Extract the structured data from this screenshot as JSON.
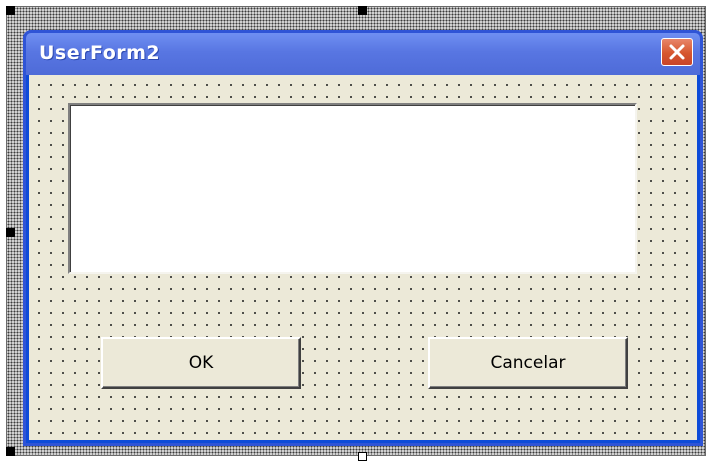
{
  "form": {
    "title": "UserForm2",
    "ok_label": "OK",
    "cancel_label": "Cancelar",
    "textbox_value": ""
  },
  "icons": {
    "close": "close-icon"
  },
  "colors": {
    "titlebar": "#5876e2",
    "close_button": "#d6562e",
    "client_background": "#ece9d8",
    "textbox_background": "#ffffff"
  }
}
